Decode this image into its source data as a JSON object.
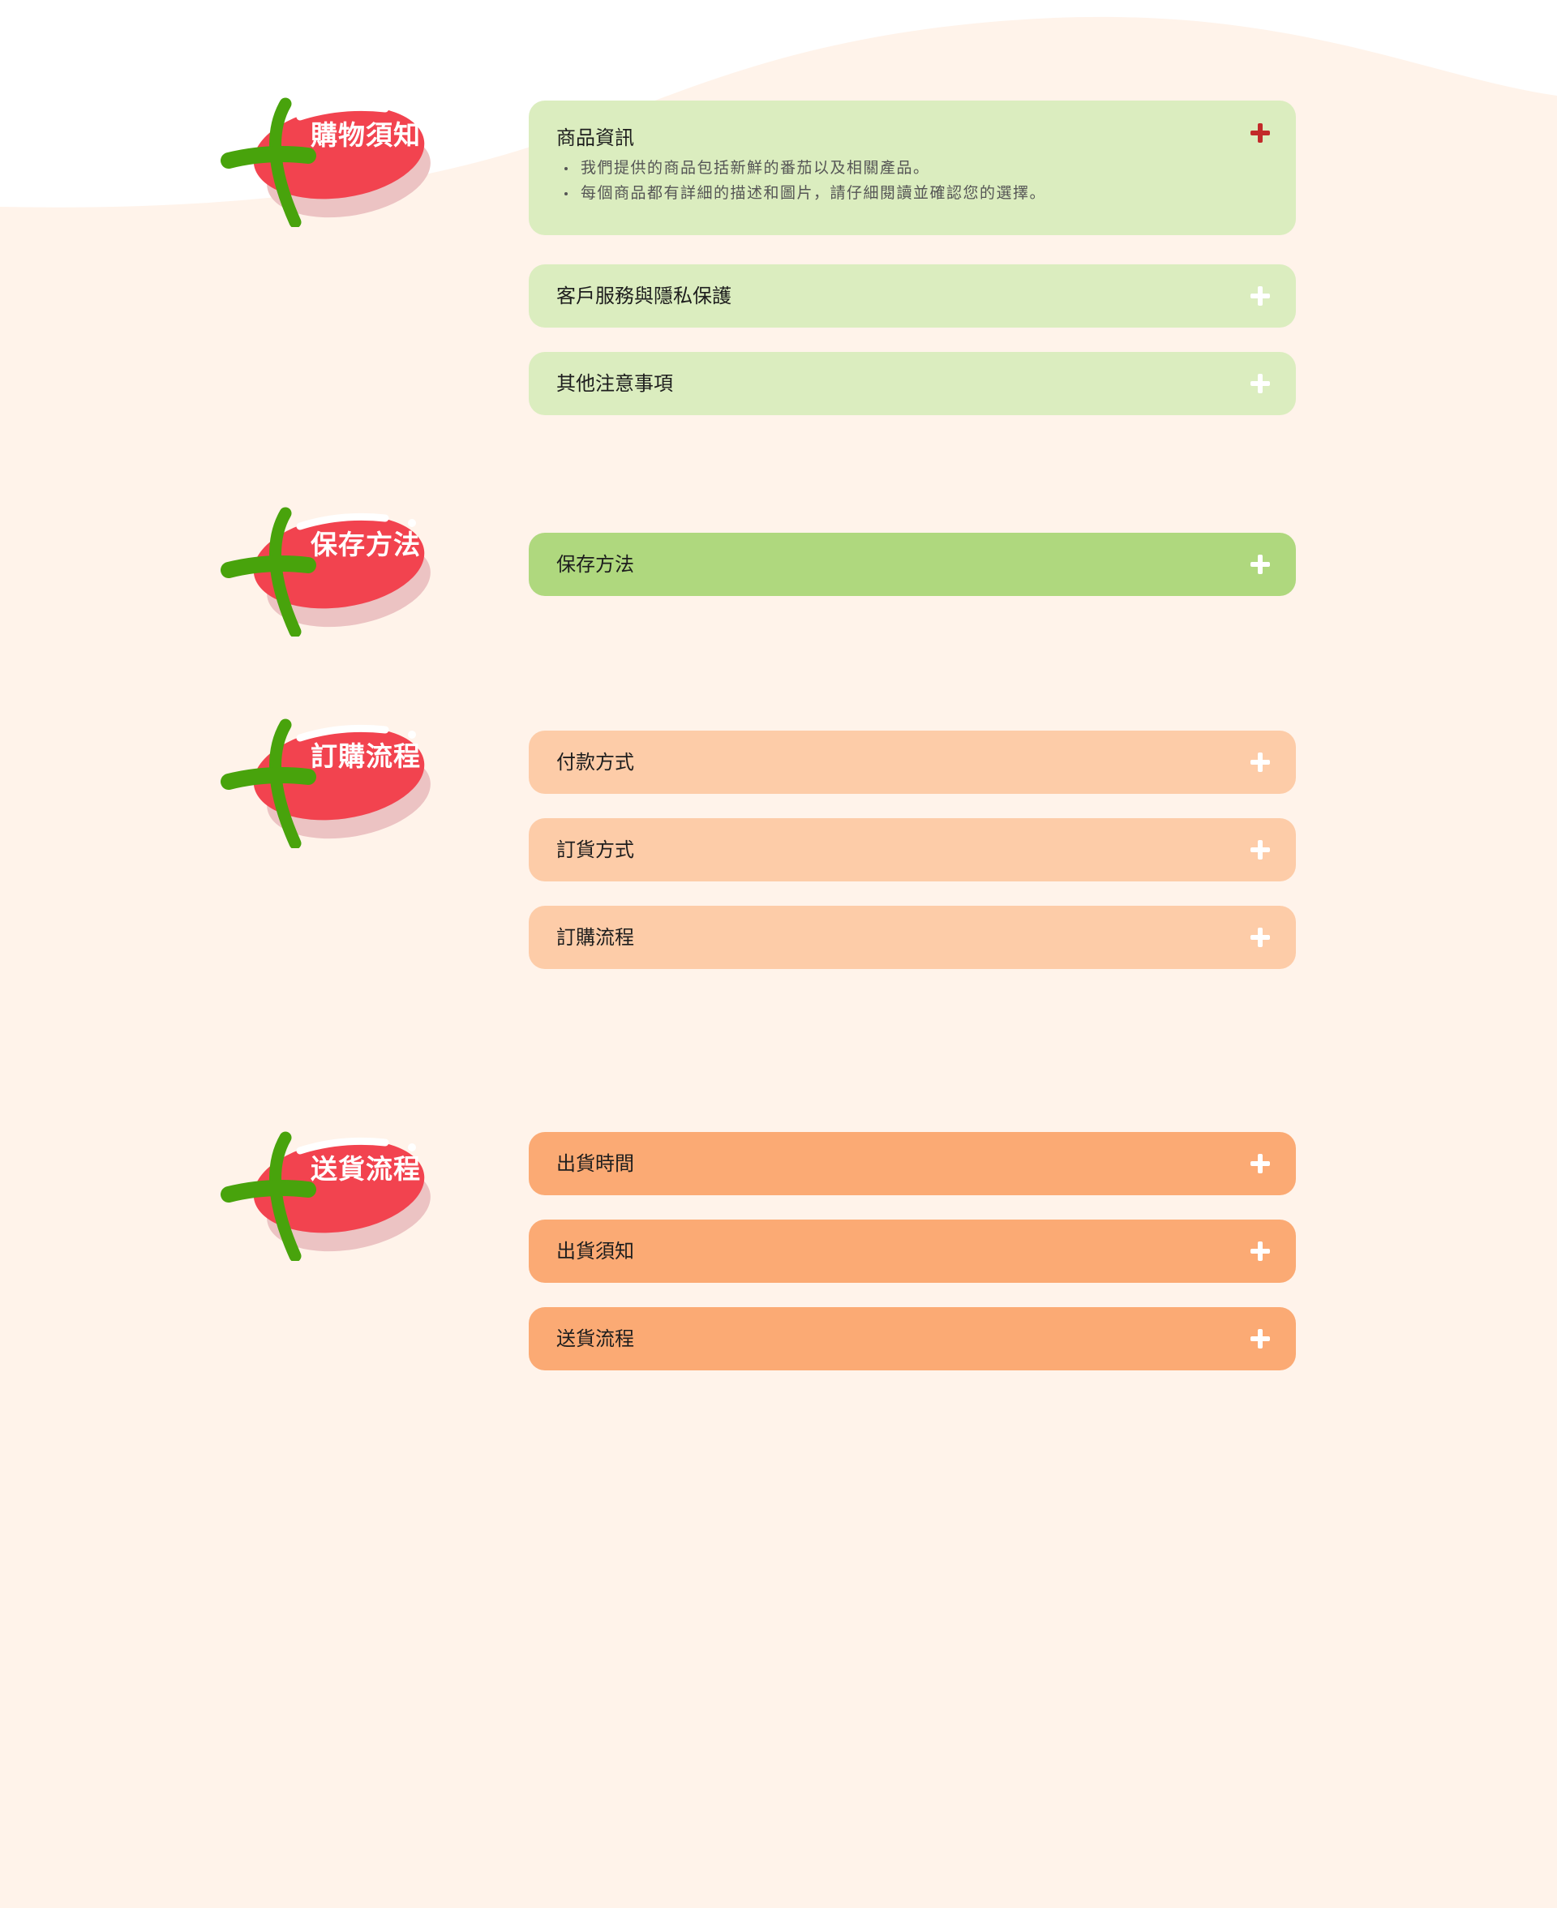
{
  "theme": {
    "page_background": "#fff3ea",
    "badge_color": "#f2434f",
    "stem_color": "#48a30c",
    "accent_plus_open": "#c22a2a"
  },
  "sections": [
    {
      "badge_label": "購物須知",
      "color": "#dbedbf",
      "items": [
        {
          "title": "商品資訊",
          "expanded": true,
          "details": [
            "我們提供的商品包括新鮮的番茄以及相關產品。",
            "每個商品都有詳細的描述和圖片，請仔細閱讀並確認您的選擇。"
          ]
        },
        {
          "title": "客戶服務與隱私保護",
          "expanded": false
        },
        {
          "title": "其他注意事項",
          "expanded": false
        }
      ]
    },
    {
      "badge_label": "保存方法",
      "color": "#afd87e",
      "items": [
        {
          "title": "保存方法",
          "expanded": false
        }
      ]
    },
    {
      "badge_label": "訂購流程",
      "color": "#fdcca8",
      "items": [
        {
          "title": "付款方式",
          "expanded": false
        },
        {
          "title": "訂貨方式",
          "expanded": false
        },
        {
          "title": "訂購流程",
          "expanded": false
        }
      ]
    },
    {
      "badge_label": "送貨流程",
      "color": "#fbaa74",
      "items": [
        {
          "title": "出貨時間",
          "expanded": false
        },
        {
          "title": "出貨須知",
          "expanded": false
        },
        {
          "title": "送貨流程",
          "expanded": false
        }
      ]
    }
  ]
}
